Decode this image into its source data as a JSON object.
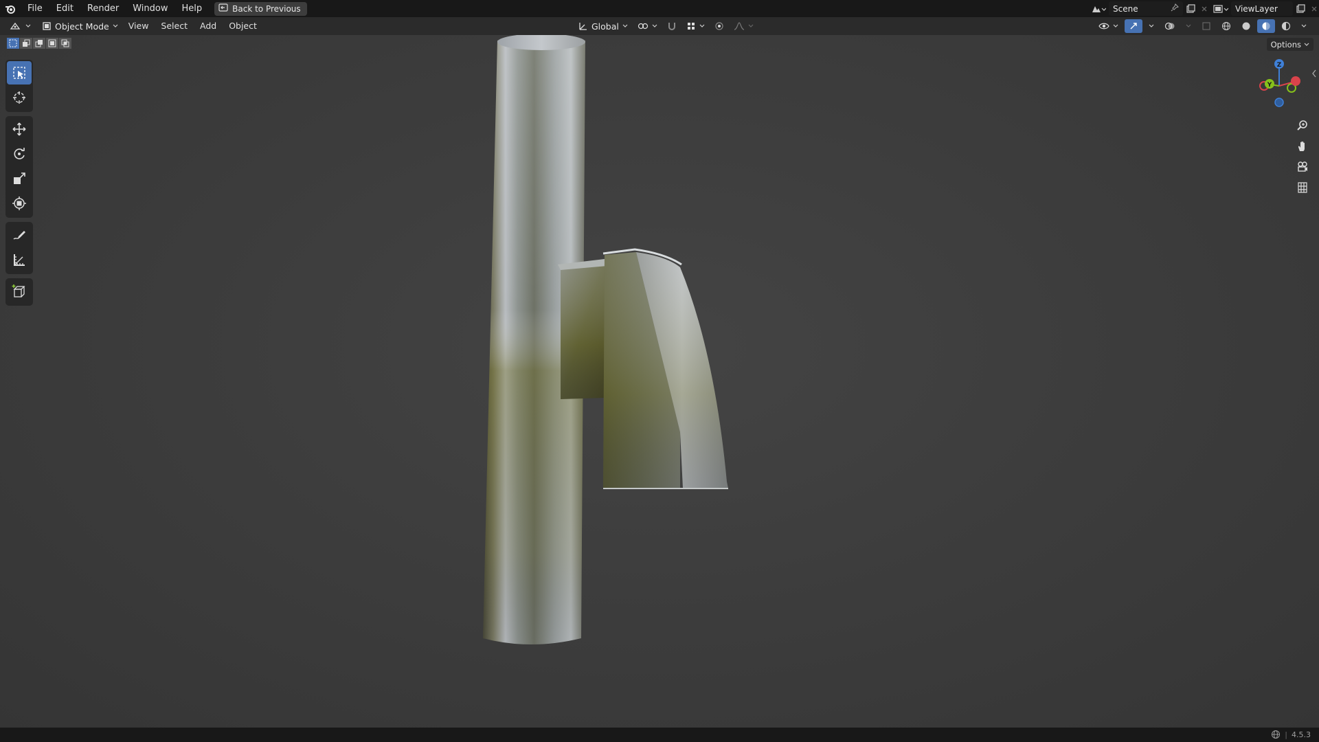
{
  "topbar": {
    "menus": [
      "File",
      "Edit",
      "Render",
      "Window",
      "Help"
    ],
    "back_label": "Back to Previous",
    "scene_name": "Scene",
    "view_layer": "ViewLayer"
  },
  "header": {
    "mode": "Object Mode",
    "menus": [
      "View",
      "Select",
      "Add",
      "Object"
    ],
    "transform_orientation": "Global"
  },
  "viewport": {
    "options_label": "Options",
    "gizmo_axes": {
      "z": "Z",
      "y": "Y",
      "x": "X"
    }
  },
  "toolbar": {
    "tools": [
      "select-box",
      "cursor",
      "move",
      "rotate",
      "scale",
      "transform",
      "annotate",
      "measure",
      "add-cube"
    ],
    "active_tool": "select-box"
  },
  "status": {
    "version": "4.5.3"
  },
  "colors": {
    "accent": "#4772b3",
    "axis_x": "#d9434b",
    "axis_y": "#86c11b",
    "axis_z": "#3f80d8"
  }
}
